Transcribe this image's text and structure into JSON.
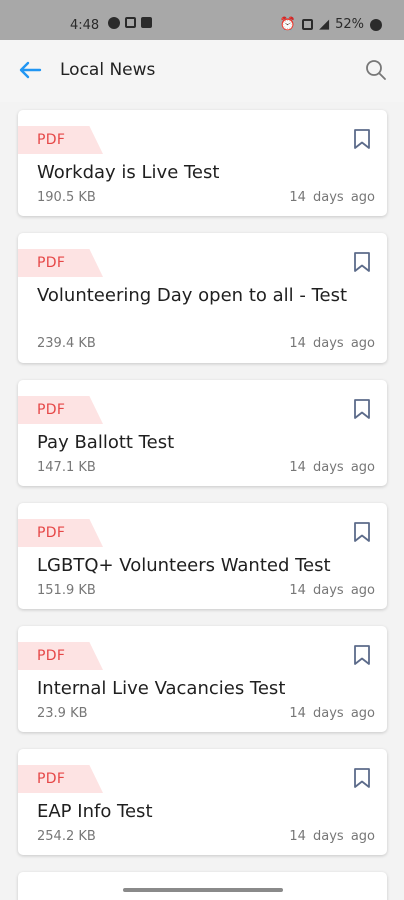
{
  "status_bar": {
    "time": "4:48",
    "battery": "52%",
    "icons": [
      "circle-app-icon",
      "gallery-icon",
      "image-icon",
      "alarm-icon",
      "sim-icon",
      "signal-icon",
      "battery-icon"
    ]
  },
  "header": {
    "title": "Local News",
    "back_icon": "back-arrow-icon",
    "search_icon": "search-icon",
    "accent_color": "#2196f3"
  },
  "items": [
    {
      "tag": "PDF",
      "title": "Workday is Live Test",
      "size": "190.5 KB",
      "date": "14  days ago"
    },
    {
      "tag": "PDF",
      "title": "Volunteering Day open to all - Test",
      "size": "239.4 KB",
      "date": "14  days ago"
    },
    {
      "tag": "PDF",
      "title": "Pay Ballott Test",
      "size": "147.1 KB",
      "date": "14  days ago"
    },
    {
      "tag": "PDF",
      "title": "LGBTQ+ Volunteers Wanted Test",
      "size": "151.9 KB",
      "date": "14  days ago"
    },
    {
      "tag": "PDF",
      "title": "Internal Live Vacancies Test",
      "size": "23.9 KB",
      "date": "14  days ago"
    },
    {
      "tag": "PDF",
      "title": "EAP Info Test",
      "size": "254.2 KB",
      "date": "14  days ago"
    }
  ],
  "colors": {
    "pdf_tag_bg": "#fde3e3",
    "pdf_tag_text": "#e64747",
    "bookmark": "#5c6b8a"
  }
}
